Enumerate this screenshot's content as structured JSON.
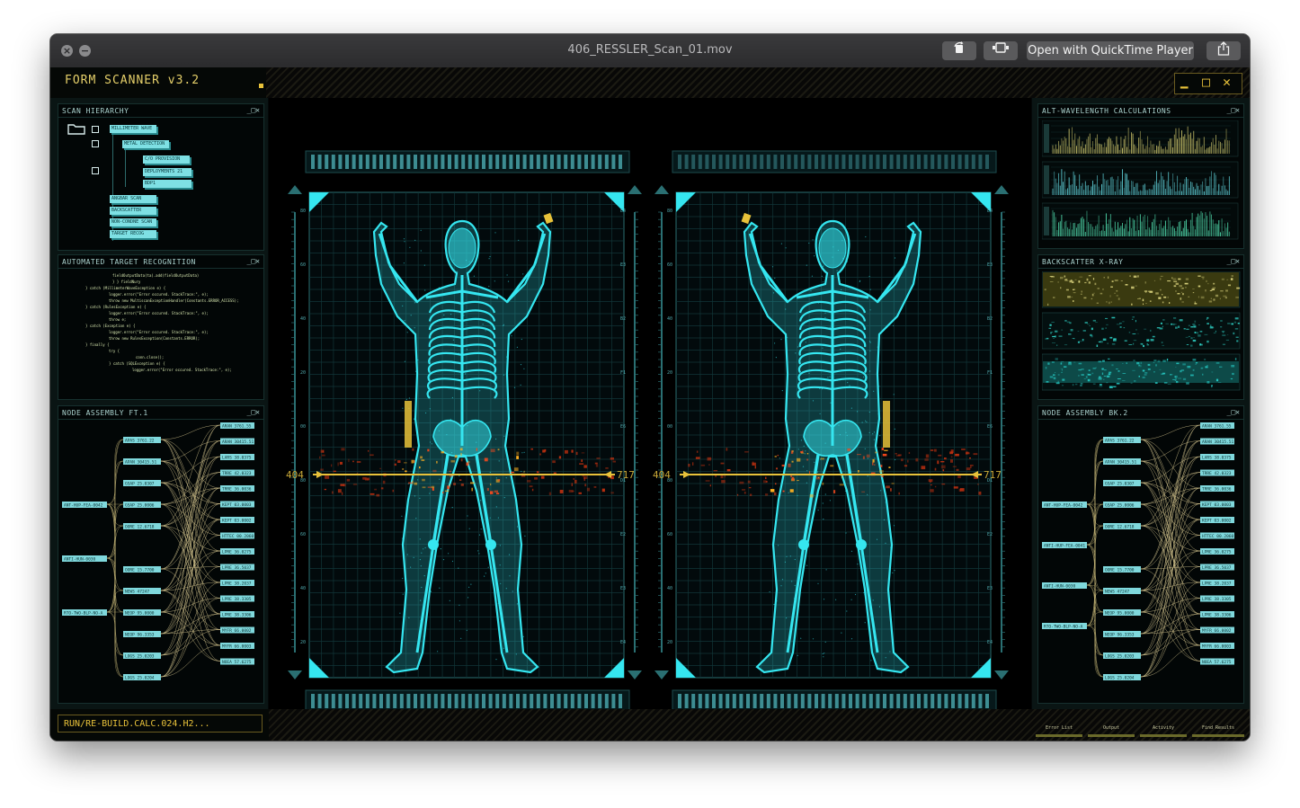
{
  "window": {
    "title": "406_RESSLER_Scan_01.mov",
    "open_button_label": "Open with QuickTime Player",
    "rotate_icon": "rotate-icon",
    "trim_icon": "trim-icon",
    "share_icon": "share-icon"
  },
  "app": {
    "title": "FORM SCANNER v3.2",
    "minimize_glyph": "▁",
    "maximize_glyph": "□",
    "close_glyph": "✕",
    "command_text": "RUN/RE-BUILD.CALC.024.H2..."
  },
  "panels": {
    "scan_hierarchy": {
      "title": "SCAN HIERARCHY",
      "controls": "_□✕",
      "nodes": [
        "MILLIMETER WAVE",
        "METAL DETECTION",
        "C/O PROVISION",
        "DEPLOYMENTS 21",
        "BDP1",
        "ANGBAR SCAN",
        "BACKSCATTER",
        "NON-CONDNE SCAN",
        "TARGET RECOG"
      ]
    },
    "target_recognition": {
      "title": "AUTOMATED TARGET RECOGNITION",
      "controls": "_□✕",
      "code": [
        "fieldOutputData(ta).add(fieldOutputData)",
        "} } fieldNury",
        "} catch (MillimeterWaveException e) {",
        "logger.error(\"Error occured. StackTrace:\", e);",
        "throw new MultiscanExceptionHandler(Constants.ERROR_ACCESS);",
        "} catch (RulesException e) {",
        "logger.error(\"Error occured. StackTrace:\", e);",
        "throw e;",
        "} catch (Exception e) {",
        "logger.error(\"Error occured. StackTrace:\", e);",
        "throw new RulesException(Constants.ERROR);",
        "} finally {",
        "try {",
        "conn.close();",
        "} catch (SQLException e) {",
        "logger.error(\"Error occured. StackTrace:\", e);"
      ]
    },
    "node_assembly_left": {
      "title": "NODE ASSEMBLY FT.1",
      "controls": "_□✕",
      "left_nodes": [
        "ANT-HUP-FEA-0042",
        "ANTI-HUN-0030",
        "RTO-TWO-BLP-NO-A"
      ],
      "mid_nodes": [
        "APAS 3761.22",
        "APAN 30415.51",
        "GSAP 25.0307",
        "GSAP 25.0006",
        "OORE 12.6718",
        "OORE 15.7700",
        "NEWS 47247",
        "NEOP 95.0000",
        "NEOP 96.3353",
        "LOGS 25.0203",
        "LOGS 25.0204"
      ],
      "right_nodes": [
        "ARAN 3761.55",
        "ARAN 30415.51",
        "LARS 38.0375",
        "TRRE 42.0323",
        "TRRE 36.0036",
        "KEPT 03.0003",
        "KEPT 03.0002",
        "HTTEC 00.2060",
        "LPRE 36.0275",
        "LPRE 36.5037",
        "LPRE 38.2037",
        "LPRE 38.3305",
        "LPRE 38.3306",
        "MYFR 66.0002",
        "MYFR 66.0003",
        "NOEA 57.6275"
      ]
    },
    "alt_wavelength": {
      "title": "ALT-WAVELENGTH CALCULATIONS",
      "controls": "_□✕"
    },
    "backscatter": {
      "title": "BACKSCATTER X-RAY",
      "controls": "_□✕"
    },
    "node_assembly_right": {
      "title": "NODE ASSEMBLY BK.2",
      "controls": "_□✕",
      "left_nodes": [
        "ANT-HUP-FEA-0042",
        "ANTI-HUP-FEA-0041",
        "ANTI-HUN-0030",
        "RTO-TWO-BLP-NO-A"
      ],
      "mid_nodes": [
        "APAS 3761.22",
        "APAN 30415.51",
        "GSAP 25.0307",
        "GSAP 25.0006",
        "OORE 12.6718",
        "OORE 15.7700",
        "NEWS 47247",
        "NEOP 95.0000",
        "NEOP 96.3353",
        "LOGS 25.0203",
        "LOGS 25.0204"
      ],
      "right_nodes": [
        "ARAN 3761.55",
        "ARAN 30415.51",
        "LARS 38.0375",
        "TRRE 42.0323",
        "TRRE 36.0036",
        "KEPT 03.0003",
        "KEPT 03.0002",
        "HTTEC 00.2060",
        "LPRE 36.0275",
        "LPRE 36.5037",
        "LPRE 38.2037",
        "LPRE 38.3305",
        "LPRE 38.3306",
        "MYFR 66.0002",
        "MYFR 66.0003",
        "NOEA 57.6275"
      ]
    }
  },
  "scans": {
    "left_marker": "404",
    "right_marker": "717",
    "left_scale": [
      "80",
      "60",
      "40",
      "20",
      "00",
      "80",
      "60",
      "40",
      "20"
    ],
    "right_scale": [
      "E4",
      "E3",
      "B2",
      "F1",
      "E6",
      "D1",
      "E2",
      "E3",
      "E4"
    ]
  },
  "footer_tabs": [
    "Error List",
    "Output",
    "Activity",
    "Find Results"
  ],
  "colors": {
    "cyan": "#35e6f0",
    "amber": "#e8c23a",
    "scan_red": "#ff4a1c",
    "panel_text": "#aad2ce"
  }
}
